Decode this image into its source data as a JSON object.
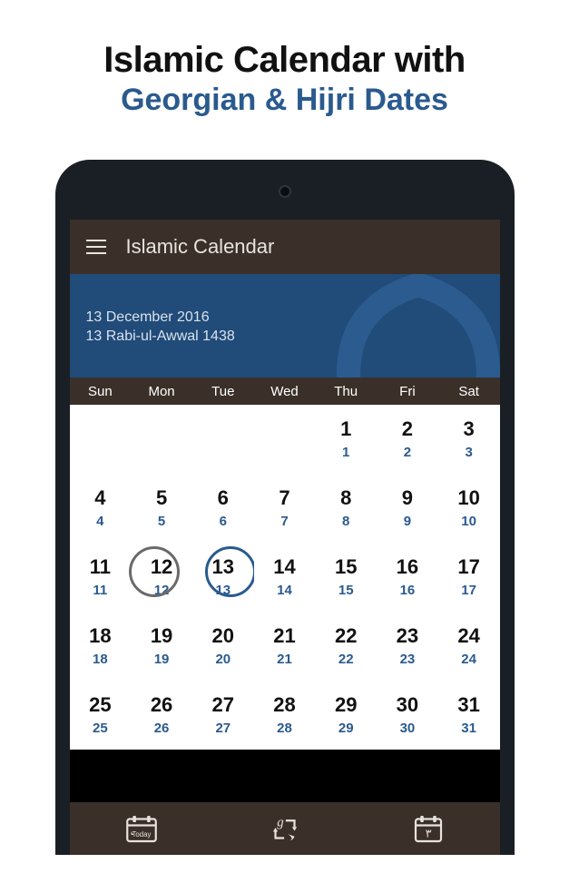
{
  "promo": {
    "line1": "Islamic Calendar with",
    "line2": "Georgian & Hijri Dates"
  },
  "appbar": {
    "title": "Islamic Calendar"
  },
  "hero": {
    "gregorian": "13 December 2016",
    "hijri": "13 Rabi-ul-Awwal 1438"
  },
  "weekdays": [
    "Sun",
    "Mon",
    "Tue",
    "Wed",
    "Thu",
    "Fri",
    "Sat"
  ],
  "days": [
    {
      "g": "",
      "h": ""
    },
    {
      "g": "",
      "h": ""
    },
    {
      "g": "",
      "h": ""
    },
    {
      "g": "",
      "h": ""
    },
    {
      "g": "1",
      "h": "1"
    },
    {
      "g": "2",
      "h": "2"
    },
    {
      "g": "3",
      "h": "3"
    },
    {
      "g": "4",
      "h": "4"
    },
    {
      "g": "5",
      "h": "5"
    },
    {
      "g": "6",
      "h": "6"
    },
    {
      "g": "7",
      "h": "7"
    },
    {
      "g": "8",
      "h": "8"
    },
    {
      "g": "9",
      "h": "9"
    },
    {
      "g": "10",
      "h": "10"
    },
    {
      "g": "11",
      "h": "11"
    },
    {
      "g": "12",
      "h": "12",
      "today": true
    },
    {
      "g": "13",
      "h": "13",
      "selected": true
    },
    {
      "g": "14",
      "h": "14"
    },
    {
      "g": "15",
      "h": "15"
    },
    {
      "g": "16",
      "h": "16"
    },
    {
      "g": "17",
      "h": "17"
    },
    {
      "g": "18",
      "h": "18"
    },
    {
      "g": "19",
      "h": "19"
    },
    {
      "g": "20",
      "h": "20"
    },
    {
      "g": "21",
      "h": "21"
    },
    {
      "g": "22",
      "h": "22"
    },
    {
      "g": "23",
      "h": "23"
    },
    {
      "g": "24",
      "h": "24"
    },
    {
      "g": "25",
      "h": "25"
    },
    {
      "g": "26",
      "h": "26"
    },
    {
      "g": "27",
      "h": "27"
    },
    {
      "g": "28",
      "h": "28"
    },
    {
      "g": "29",
      "h": "29"
    },
    {
      "g": "30",
      "h": "30"
    },
    {
      "g": "31",
      "h": "31"
    }
  ],
  "bottom": {
    "today": "Today",
    "convert": "Convert",
    "events": "Events"
  }
}
